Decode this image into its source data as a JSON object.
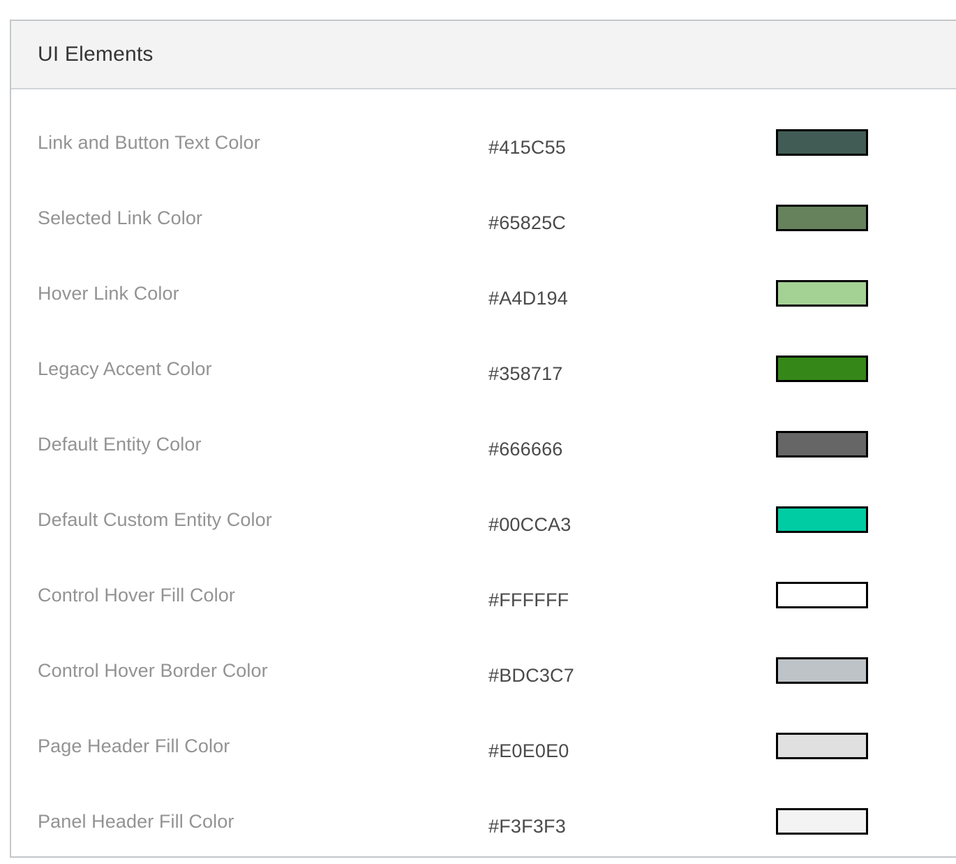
{
  "panel": {
    "title": "UI Elements"
  },
  "table": {
    "rows": [
      {
        "label": "Link and Button Text Color",
        "value": "#415C55",
        "swatch": "#415C55"
      },
      {
        "label": "Selected Link Color",
        "value": "#65825C",
        "swatch": "#65825C"
      },
      {
        "label": "Hover Link Color",
        "value": "#A4D194",
        "swatch": "#A4D194"
      },
      {
        "label": "Legacy Accent Color",
        "value": "#358717",
        "swatch": "#358717"
      },
      {
        "label": "Default Entity Color",
        "value": "#666666",
        "swatch": "#666666"
      },
      {
        "label": "Default Custom Entity Color",
        "value": "#00CCA3",
        "swatch": "#00CCA3"
      },
      {
        "label": "Control Hover Fill Color",
        "value": "#FFFFFF",
        "swatch": "#FFFFFF"
      },
      {
        "label": "Control Hover Border Color",
        "value": "#BDC3C7",
        "swatch": "#BDC3C7"
      },
      {
        "label": "Page Header Fill Color",
        "value": "#E0E0E0",
        "swatch": "#E0E0E0"
      },
      {
        "label": "Panel Header Fill Color",
        "value": "#F3F3F3",
        "swatch": "#F3F3F3"
      }
    ]
  },
  "theme": {
    "panel_border_color": "#C3C7CA",
    "panel_header_fill": "#F3F3F3",
    "panel_header_border": "#D2D5D7",
    "label_text_color": "#939393",
    "value_text_color": "#4A4A4A",
    "title_text_color": "#353535",
    "swatch_border_color": "#000000"
  }
}
